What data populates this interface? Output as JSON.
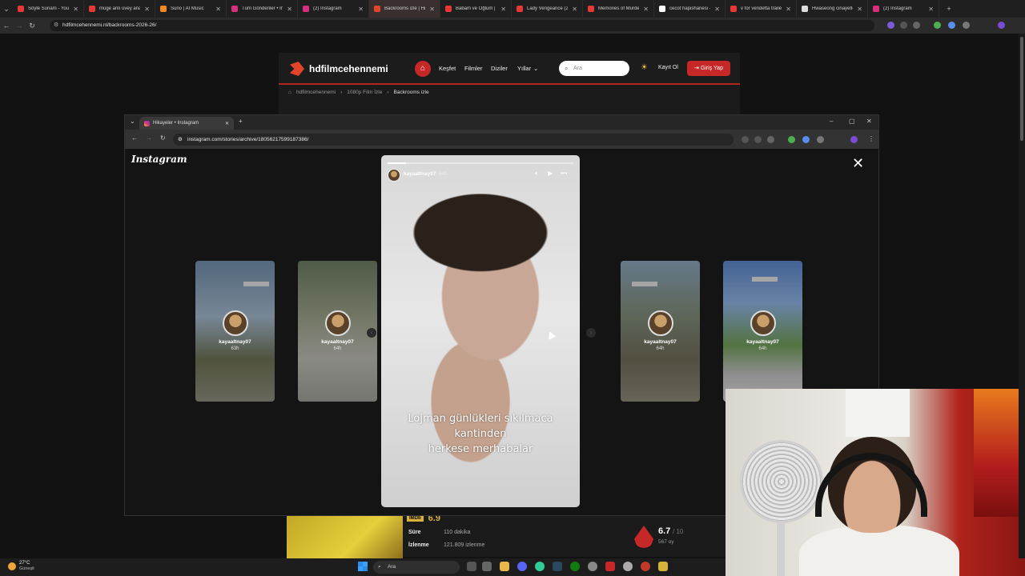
{
  "outer_browser": {
    "tabs": [
      {
        "label": "Söyle Sunam - YouT",
        "color": "#e53935"
      },
      {
        "label": "müge anlı üvey ana",
        "color": "#e53935"
      },
      {
        "label": "Suno | AI Music",
        "color": "#f08a24"
      },
      {
        "label": "Tüm Gönderiler • In",
        "color": "#d6307d"
      },
      {
        "label": "(2) Instagram",
        "color": "#d6307d"
      },
      {
        "label": "Backrooms izle | Hd",
        "color": "#e1452b",
        "active": true
      },
      {
        "label": "Babam ve Oğlum |",
        "color": "#e53935"
      },
      {
        "label": "Lady Vengeance (2(",
        "color": "#e53935"
      },
      {
        "label": "Memories of Murde",
        "color": "#e53935"
      },
      {
        "label": "cecot hapishanesi -",
        "color": "#ffffff"
      },
      {
        "label": "v for vendetta traile",
        "color": "#e53935"
      },
      {
        "label": "Hwaseong cinayetle",
        "color": "#dddddd"
      },
      {
        "label": "(2) Instagram",
        "color": "#d6307d"
      }
    ],
    "url": "hdfilmcehennemi.nl/backrooms-2026-26/"
  },
  "site": {
    "logo": "hdfilmcehennemi",
    "nav": [
      "Keşfet",
      "Filmler",
      "Diziler",
      "Yıllar"
    ],
    "search_placeholder": "Ara",
    "signup": "Kayıt Ol",
    "login": "Giriş Yap",
    "breadcrumb": [
      "hdfilmcehennemi",
      "1080p Film İzle",
      "Backrooms izle"
    ],
    "imdb_score": "6.9",
    "duration_label": "Süre",
    "duration_value": "110 dakika",
    "views_label": "İzlenme",
    "views_value": "121.809 izlenme",
    "rating": "6.7",
    "rating_max": "/ 10",
    "votes": "567 oy"
  },
  "inner_browser": {
    "tab_title": "Hikayeler • Instagram",
    "url": "instagram.com/stories/archive/18056217599187386/"
  },
  "instagram": {
    "logo": "Instagram",
    "story": {
      "username": "kayaaltnay07",
      "time": "64h",
      "progress": 0.1,
      "caption_line1": "Lojman günlükleri sıkılmaca kantinden",
      "caption_line2": "herkese merhabalar"
    },
    "thumbs": [
      {
        "username": "kayaaltnay07",
        "time": "63h"
      },
      {
        "username": "kayaaltnay07",
        "time": "64h"
      },
      {
        "username": "kayaaltnay07",
        "time": "64h"
      },
      {
        "username": "kayaaltnay07",
        "time": "64h"
      }
    ]
  },
  "taskbar": {
    "temp": "27°C",
    "weather": "Güneşli",
    "search": "Ara"
  }
}
